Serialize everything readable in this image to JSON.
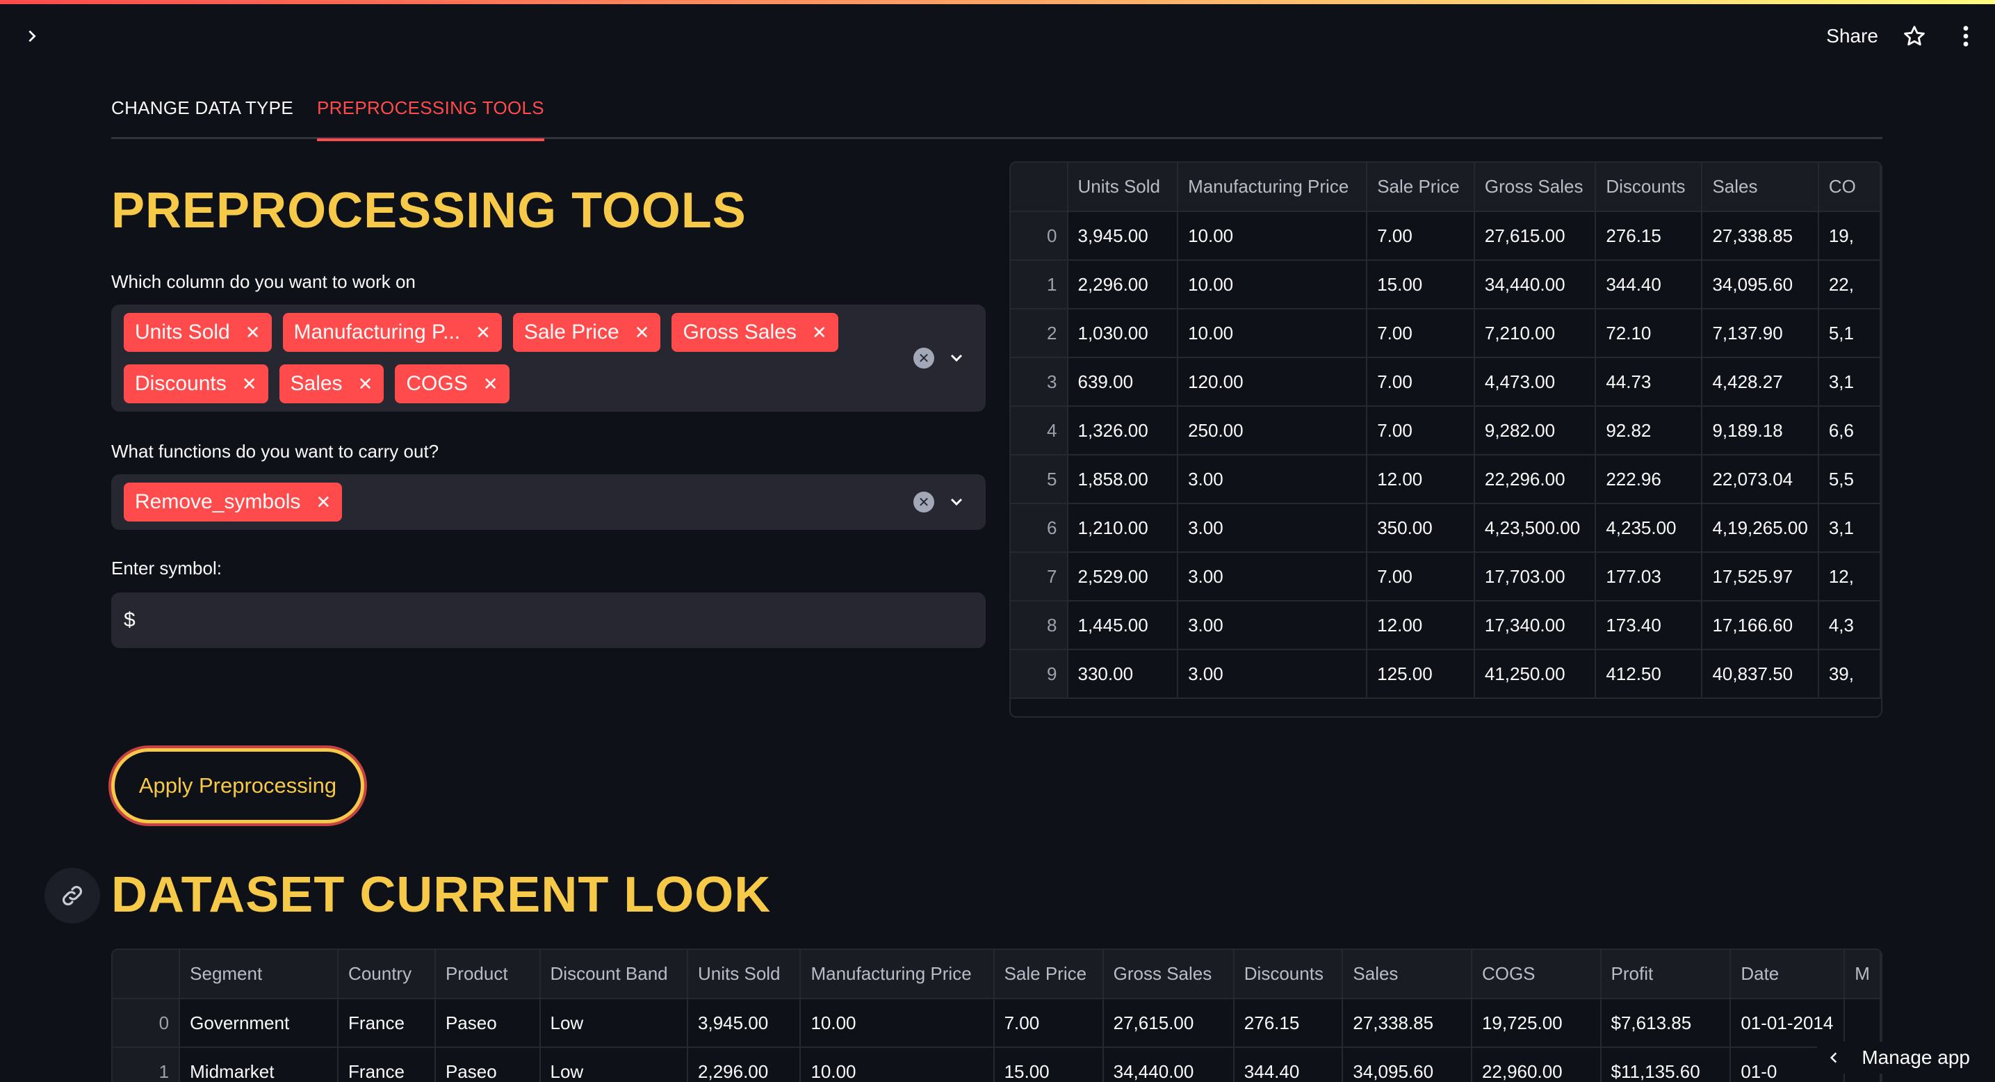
{
  "header": {
    "share_label": "Share"
  },
  "tabs": [
    {
      "label": "CHANGE DATA TYPE",
      "active": false
    },
    {
      "label": "PREPROCESSING TOOLS",
      "active": true
    }
  ],
  "preprocessing": {
    "title": "PREPROCESSING TOOLS",
    "column_label": "Which column do you want to work on",
    "selected_columns": [
      "Units Sold",
      "Manufacturing P...",
      "Sale Price",
      "Gross Sales",
      "Discounts",
      "Sales",
      "COGS"
    ],
    "function_label": "What functions do you want to carry out?",
    "selected_functions": [
      "Remove_symbols"
    ],
    "symbol_label": "Enter symbol:",
    "symbol_value": "$",
    "apply_label": "Apply Preprocessing"
  },
  "preview_table": {
    "columns": [
      "",
      "Units Sold",
      "Manufacturing Price",
      "Sale Price",
      "Gross Sales",
      "Discounts",
      "Sales",
      "CO"
    ],
    "rows": [
      [
        "0",
        "3,945.00",
        "10.00",
        "7.00",
        "27,615.00",
        "276.15",
        "27,338.85",
        "19,"
      ],
      [
        "1",
        "2,296.00",
        "10.00",
        "15.00",
        "34,440.00",
        "344.40",
        "34,095.60",
        "22,"
      ],
      [
        "2",
        "1,030.00",
        "10.00",
        "7.00",
        "7,210.00",
        "72.10",
        "7,137.90",
        "5,1"
      ],
      [
        "3",
        "639.00",
        "120.00",
        "7.00",
        "4,473.00",
        "44.73",
        "4,428.27",
        "3,1"
      ],
      [
        "4",
        "1,326.00",
        "250.00",
        "7.00",
        "9,282.00",
        "92.82",
        "9,189.18",
        "6,6"
      ],
      [
        "5",
        "1,858.00",
        "3.00",
        "12.00",
        "22,296.00",
        "222.96",
        "22,073.04",
        "5,5"
      ],
      [
        "6",
        "1,210.00",
        "3.00",
        "350.00",
        "4,23,500.00",
        "4,235.00",
        "4,19,265.00",
        "3,1"
      ],
      [
        "7",
        "2,529.00",
        "3.00",
        "7.00",
        "17,703.00",
        "177.03",
        "17,525.97",
        "12,"
      ],
      [
        "8",
        "1,445.00",
        "3.00",
        "12.00",
        "17,340.00",
        "173.40",
        "17,166.60",
        "4,3"
      ],
      [
        "9",
        "330.00",
        "3.00",
        "125.00",
        "41,250.00",
        "412.50",
        "40,837.50",
        "39,"
      ]
    ]
  },
  "dataset": {
    "title": "DATASET CURRENT LOOK",
    "columns": [
      "",
      "Segment",
      "Country",
      "Product",
      "Discount Band",
      "Units Sold",
      "Manufacturing Price",
      "Sale Price",
      "Gross Sales",
      "Discounts",
      "Sales",
      "COGS",
      "Profit",
      "Date",
      "M"
    ],
    "rows": [
      [
        "0",
        "Government",
        "France",
        "Paseo",
        "Low",
        "3,945.00",
        "10.00",
        "7.00",
        "27,615.00",
        "276.15",
        "27,338.85",
        "19,725.00",
        "$7,613.85",
        "01-01-2014",
        ""
      ],
      [
        "1",
        "Midmarket",
        "France",
        "Paseo",
        "Low",
        "2,296.00",
        "10.00",
        "15.00",
        "34,440.00",
        "344.40",
        "34,095.60",
        "22,960.00",
        "$11,135.60",
        "01-0",
        ""
      ]
    ]
  },
  "footer": {
    "manage_app_label": "Manage app"
  }
}
